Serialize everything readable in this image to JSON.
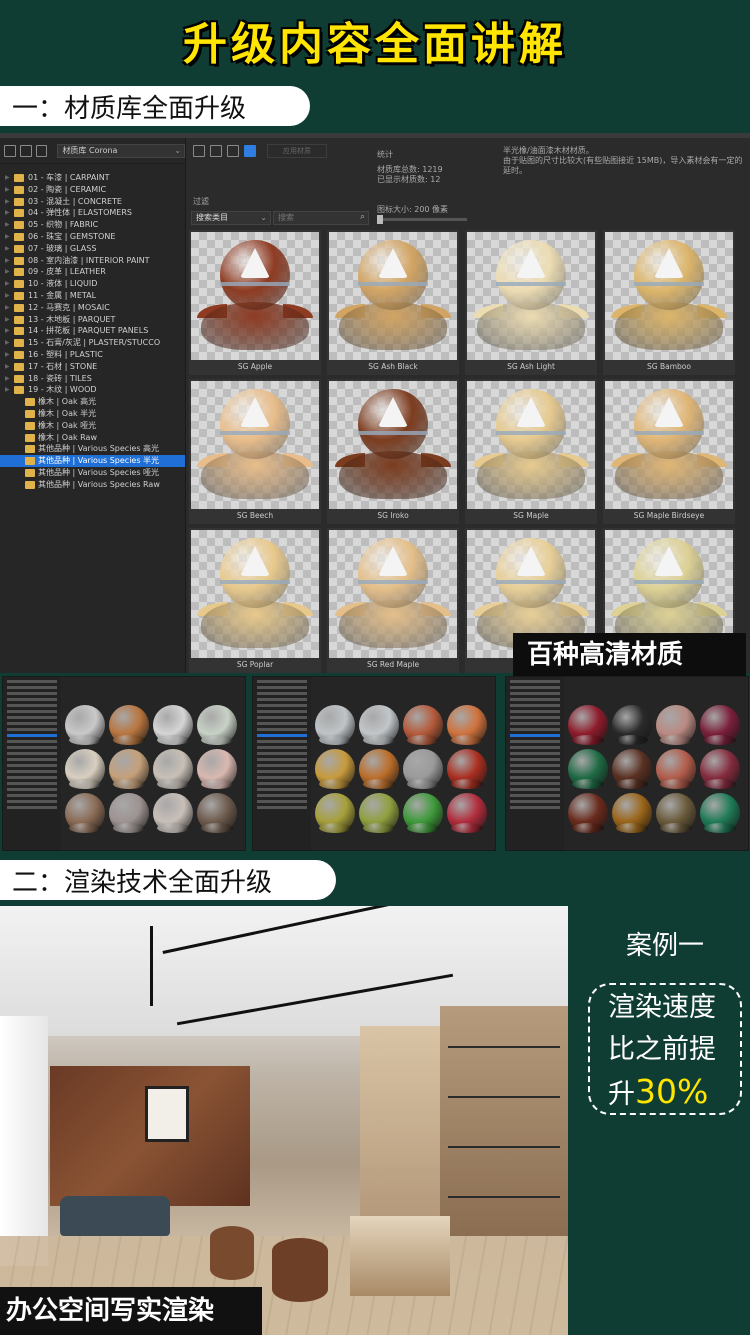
{
  "title": "升级内容全面讲解",
  "section1": "一：材质库全面升级",
  "section2": "二：渲染技术全面升级",
  "window": {
    "library_select": "材质库 Corona",
    "disabled_button": "应用材质",
    "filter_label": "过滤",
    "category_select": "搜索类目",
    "search_placeholder": "搜索",
    "stats_title": "统计",
    "stats_total": "材质库总数: 1219",
    "stats_shown": "已显示材质数: 12",
    "size_label": "图标大小: 200 像素",
    "note_line1": "半光橡/油面漆木材材质。",
    "note_line2": "由于贴图的尺寸比较大(有些贴图接近 15MB)，导入素材会有一定的延时。",
    "tree": [
      "01 - 车漆 | CARPAINT",
      "02 - 陶瓷 | CERAMIC",
      "03 - 混凝土 | CONCRETE",
      "04 - 弹性体 | ELASTOMERS",
      "05 - 织物 | FABRIC",
      "06 - 珠宝 | GEMSTONE",
      "07 - 玻璃 | GLASS",
      "08 - 室内油漆 | INTERIOR PAINT",
      "09 - 皮革 | LEATHER",
      "10 - 液体 | LIQUID",
      "11 - 金属 | METAL",
      "12 - 马赛克 | MOSAIC",
      "13 - 木地板 | PARQUET",
      "14 - 拼花板 | PARQUET PANELS",
      "15 - 石膏/灰泥 | PLASTER/STUCCO",
      "16 - 塑料 | PLASTIC",
      "17 - 石材 | STONE",
      "18 - 瓷砖 | TILES",
      "19 - 木纹 | WOOD"
    ],
    "subtree": [
      "橡木 | Oak 高光",
      "橡木 | Oak 半光",
      "橡木 | Oak 哑光",
      "橡木 | Oak Raw",
      "其他品种 | Various Species 高光",
      "其他品种 | Various Species 半光",
      "其他品种 | Various Species 哑光",
      "其他品种 | Various Species Raw"
    ],
    "materials": [
      "SG Apple",
      "SG Ash Black",
      "SG Ash Light",
      "SG Bamboo",
      "SG Beech",
      "SG Iroko",
      "SG Maple",
      "SG Maple Birdseye",
      "SG Poplar",
      "SG Red Maple",
      "",
      ""
    ]
  },
  "badge": "百种高清材质",
  "render_caption": "办公空间写实渲染",
  "case": {
    "title": "案例一",
    "line1": "渲染速度",
    "line2": "比之前提",
    "line3a": "升",
    "line3b": "30%"
  },
  "colors": {
    "background": "#0f3d34",
    "title": "#ffe500",
    "selection": "#1f6fd6"
  }
}
